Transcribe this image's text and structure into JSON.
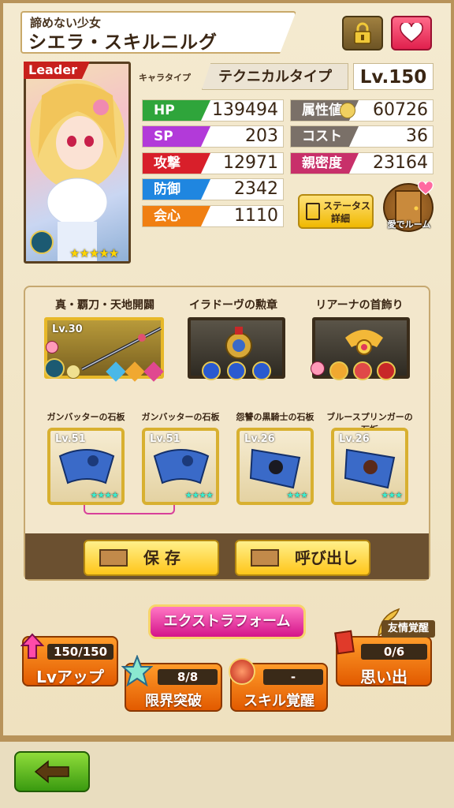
{
  "header": {
    "subtitle": "諦めない少女",
    "name": "シエラ・スキルニルグ",
    "lock_icon": "padlock-icon",
    "favorite_icon": "heart-icon"
  },
  "portrait": {
    "leader_label": "Leader",
    "stars": "★★★★★",
    "rarity": 5
  },
  "character": {
    "type_label": "キャラタイプ",
    "type_value": "テクニカルタイプ",
    "level": "Lv.150"
  },
  "stats_left": [
    {
      "label": "HP",
      "value": "139494",
      "color": "#2fa53b"
    },
    {
      "label": "SP",
      "value": "203",
      "color": "#b23ad9"
    },
    {
      "label": "攻撃",
      "value": "12971",
      "color": "#d81f2a"
    },
    {
      "label": "防御",
      "value": "2342",
      "color": "#1f86e0"
    },
    {
      "label": "会心",
      "value": "1110",
      "color": "#f07f12"
    }
  ],
  "stats_right": [
    {
      "label": "属性値",
      "value": "60726",
      "color": "#7a7068"
    },
    {
      "label": "コスト",
      "value": "36",
      "color": "#7a7068"
    },
    {
      "label": "親密度",
      "value": "23164",
      "color": "#c8306a"
    }
  ],
  "buttons": {
    "status_detail": "ステータス\n詳細",
    "status_detail_line1": "ステータス",
    "status_detail_line2": "詳細",
    "love_room": "愛でルーム"
  },
  "equipment": [
    {
      "title": "真・覇刀・天地開闢",
      "level": "Lv.30"
    },
    {
      "title": "イラドーヴの勲章",
      "level": ""
    },
    {
      "title": "リアーナの首飾り",
      "level": ""
    }
  ],
  "stones": [
    {
      "title": "ガンバッターの石板",
      "level": "Lv.51",
      "stars": "★★★★"
    },
    {
      "title": "ガンバッターの石板",
      "level": "Lv.51",
      "stars": "★★★★"
    },
    {
      "title": "怨讐の黒騎士の石板",
      "level": "Lv.26",
      "stars": "★★★"
    },
    {
      "title": "ブルースプリンガーの石板",
      "level": "Lv.26",
      "stars": "★★★"
    }
  ],
  "actions": {
    "save": "保 存",
    "load": "呼び出し"
  },
  "bottom": {
    "extra_form": "エクストラフォーム",
    "lv_up_counter": "150/150",
    "lv_up": "Lvアップ",
    "limit_counter": "8/8",
    "limit_break": "限界突破",
    "skill_counter": "-",
    "skill_awaken": "スキル覚醒",
    "friend_label": "友情覚醒",
    "memory_counter": "0/6",
    "memory": "思い出"
  },
  "colors": {
    "accent_gold": "#ffc61a",
    "back_green": "#3a9a10"
  }
}
